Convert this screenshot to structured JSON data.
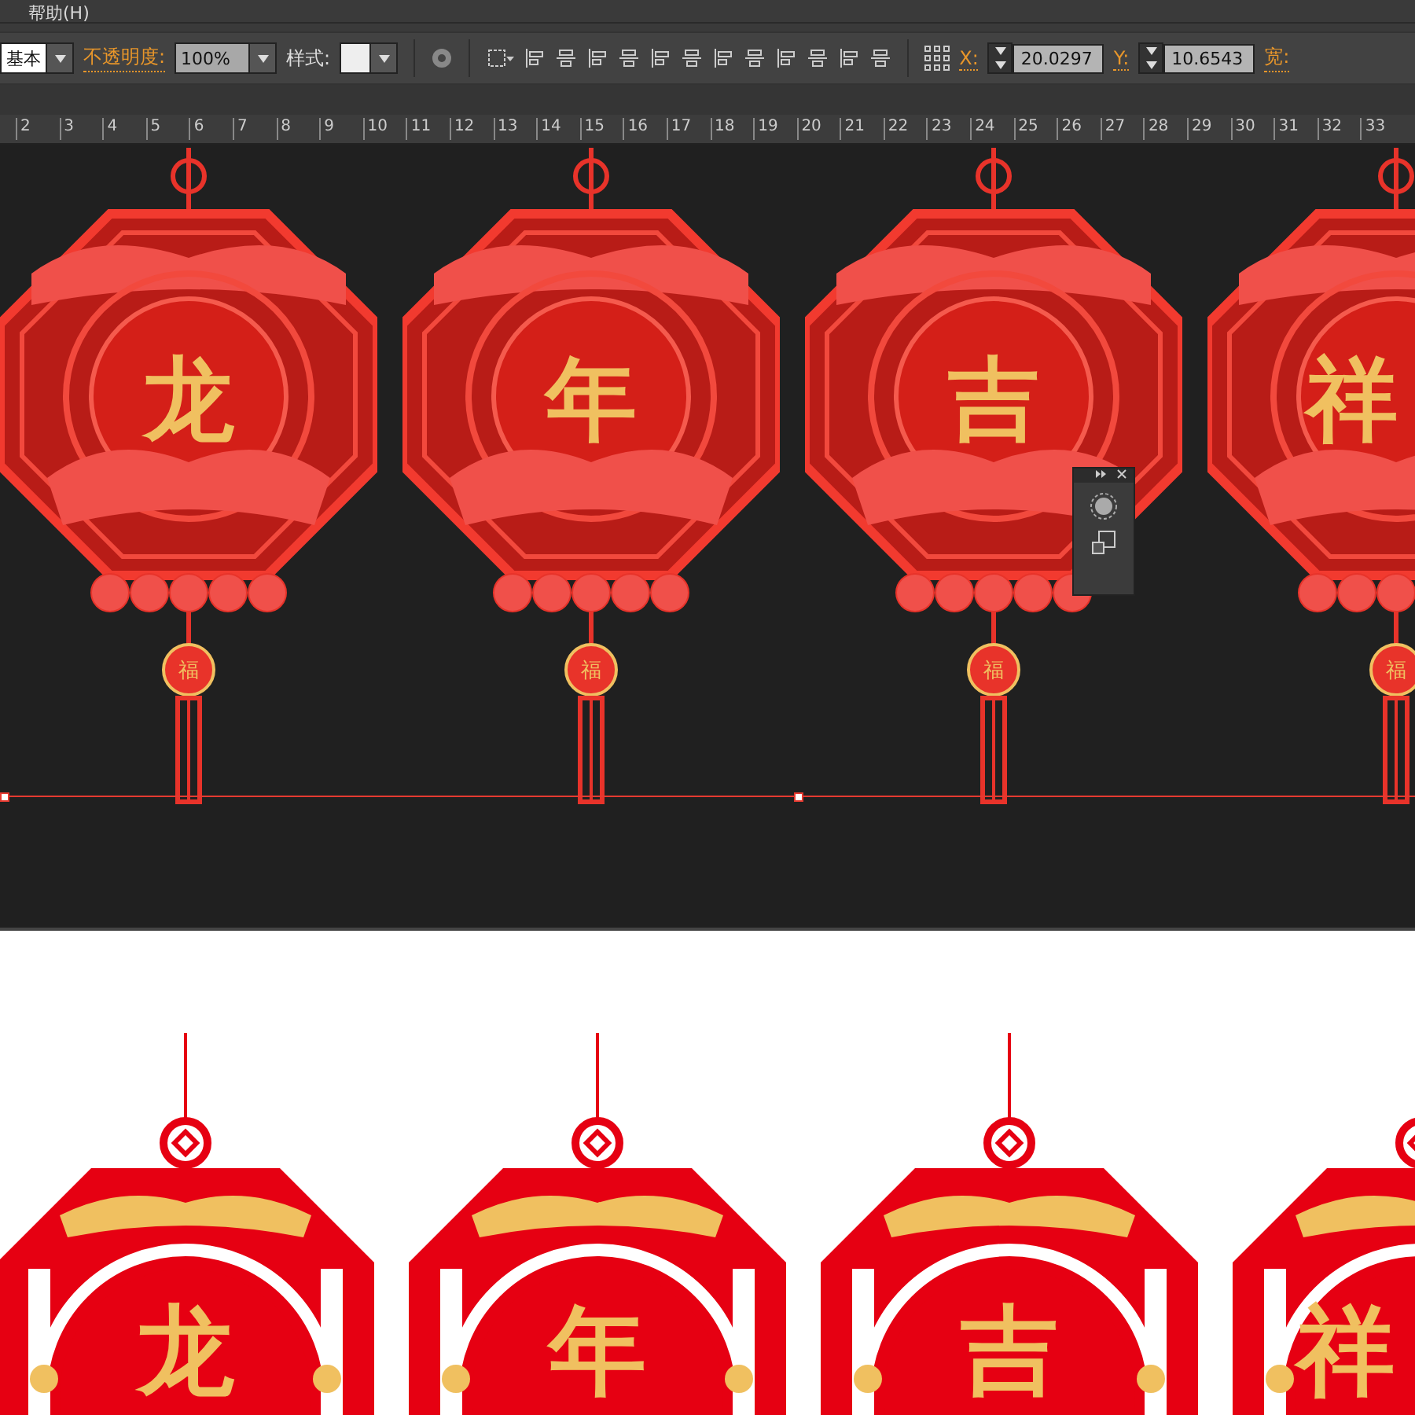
{
  "menubar": {
    "items": [
      "帮助(H)"
    ]
  },
  "control_bar": {
    "workspace": "基本",
    "opacity_label": "不透明度:",
    "opacity_value": "100%",
    "style_label": "样式:",
    "x_label": "X:",
    "x_value": "20.0297",
    "y_label": "Y:",
    "y_value": "10.6543",
    "width_label": "宽:"
  },
  "ruler": {
    "ticks": [
      "2",
      "3",
      "4",
      "5",
      "6",
      "7",
      "8",
      "9",
      "10",
      "11",
      "12",
      "13",
      "14",
      "15",
      "16",
      "17",
      "18",
      "19",
      "20",
      "21",
      "22",
      "23",
      "24",
      "25",
      "26",
      "27",
      "28",
      "29",
      "30",
      "31",
      "32",
      "33"
    ]
  },
  "canvas": {
    "ornaments": [
      {
        "character": "龙",
        "badge": "福"
      },
      {
        "character": "年",
        "badge": "福"
      },
      {
        "character": "吉",
        "badge": "福"
      },
      {
        "character": "祥",
        "badge": "福"
      }
    ]
  },
  "preview": {
    "ornaments": [
      {
        "character": "龙"
      },
      {
        "character": "年"
      },
      {
        "character": "吉"
      },
      {
        "character": "祥"
      }
    ]
  }
}
